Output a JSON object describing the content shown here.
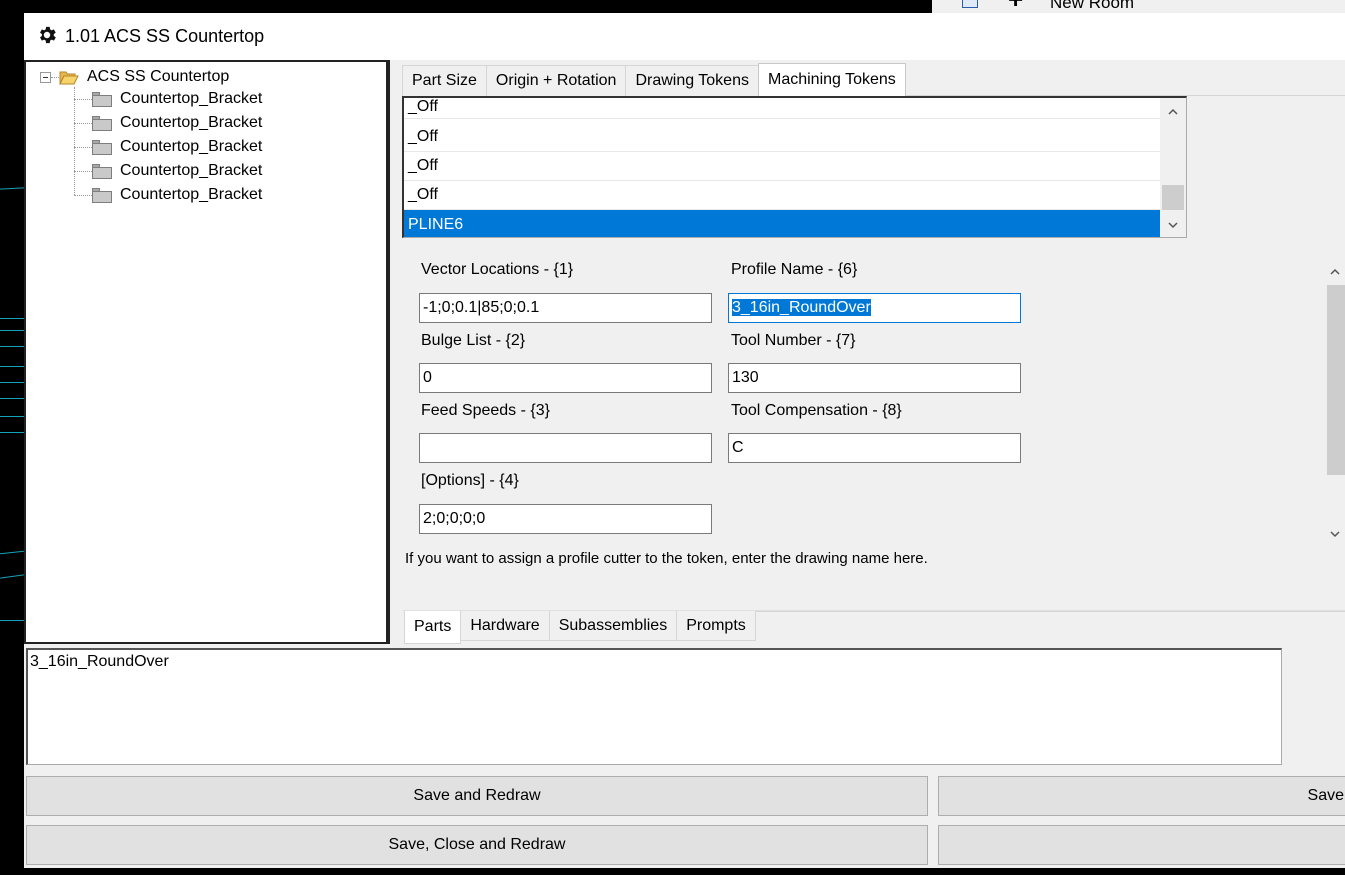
{
  "background": {
    "room_label": "New Room"
  },
  "window": {
    "title": "1.01 ACS SS Countertop",
    "icon": "gear-icon"
  },
  "tree": {
    "root": {
      "label": "ACS SS Countertop",
      "icon": "folder-open-icon"
    },
    "children": [
      {
        "label": "Countertop_Bracket",
        "icon": "folder-icon"
      },
      {
        "label": "Countertop_Bracket",
        "icon": "folder-icon"
      },
      {
        "label": "Countertop_Bracket",
        "icon": "folder-icon"
      },
      {
        "label": "Countertop_Bracket",
        "icon": "folder-icon"
      },
      {
        "label": "Countertop_Bracket",
        "icon": "folder-icon"
      }
    ]
  },
  "top_tabs": [
    {
      "label": "Part  Size",
      "active": false
    },
    {
      "label": "Origin + Rotation",
      "active": false
    },
    {
      "label": "Drawing Tokens",
      "active": false
    },
    {
      "label": "Machining Tokens",
      "active": true
    }
  ],
  "token_list": {
    "items": [
      "_Off",
      "_Off",
      "_Off",
      "_Off",
      "PLINE6"
    ],
    "selected": "PLINE6"
  },
  "fields": {
    "vector_locations": {
      "label": "Vector Locations - {1}",
      "value": "-1;0;0.1|85;0;0.1"
    },
    "bulge_list": {
      "label": "Bulge List - {2}",
      "value": "0"
    },
    "feed_speeds": {
      "label": "Feed Speeds - {3}",
      "value": ""
    },
    "options": {
      "label": "[Options] - {4}",
      "value": "2;0;0;0;0"
    },
    "profile_name": {
      "label": "Profile Name - {6}",
      "value": "3_16in_RoundOver"
    },
    "tool_number": {
      "label": "Tool Number - {7}",
      "value": "130"
    },
    "tool_compensation": {
      "label": "Tool Compensation - {8}",
      "value": "C"
    }
  },
  "hint_text": "If you want to assign a profile cutter to the token, enter the drawing name here.",
  "bottom_tabs": [
    {
      "label": "Parts",
      "active": true
    },
    {
      "label": "Hardware",
      "active": false
    },
    {
      "label": "Subassemblies",
      "active": false
    },
    {
      "label": "Prompts",
      "active": false
    }
  ],
  "description_text": "3_16in_RoundOver",
  "buttons": {
    "save_redraw": "Save and Redraw",
    "save_close_redraw": "Save, Close and Redraw",
    "save_right": "Save",
    "right_second": ""
  },
  "colors": {
    "selection": "#0078d7",
    "window_bg": "#f0f0f0",
    "desktop_bg": "#000000",
    "cad_lines": "#13a3b8"
  }
}
